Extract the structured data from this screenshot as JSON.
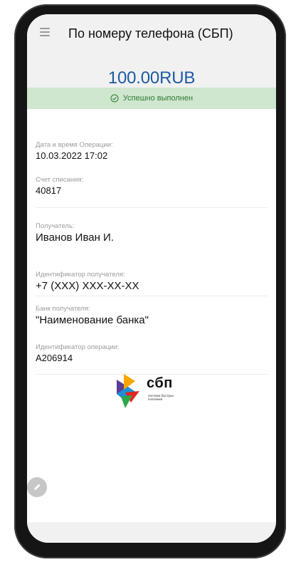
{
  "header": {
    "title": "По номеру телефона (СБП)",
    "menu_icon": "hamburger-menu-icon"
  },
  "payment": {
    "amount": "100.00RUB",
    "status_text": "Успешно выполнен",
    "status_icon": "check-circle-icon",
    "status_color": "#2f7b34"
  },
  "details": {
    "datetime_label": "Дата и время Операции:",
    "datetime_value": "10.03.2022 17:02",
    "account_label": "Счет списания:",
    "account_value": "40817",
    "recipient_label": "Получатель:",
    "recipient_value": "Иванов Иван И.",
    "recipient_id_label": "Идентификатор получателя:",
    "recipient_id_value": "+7 (XXX) XXX-XX-XX",
    "bank_label": "Банк получателя:",
    "bank_value": "\"Наименование банка\"",
    "operation_id_label": "Идентификатор операции:",
    "operation_id_value": "A206914"
  },
  "logo": {
    "word": "сбп",
    "subtitle": "система быстрых платежей"
  },
  "colors": {
    "accent": "#1d5aa4",
    "status_bg": "#cfe6cf"
  },
  "edit_icon": "pencil-icon"
}
